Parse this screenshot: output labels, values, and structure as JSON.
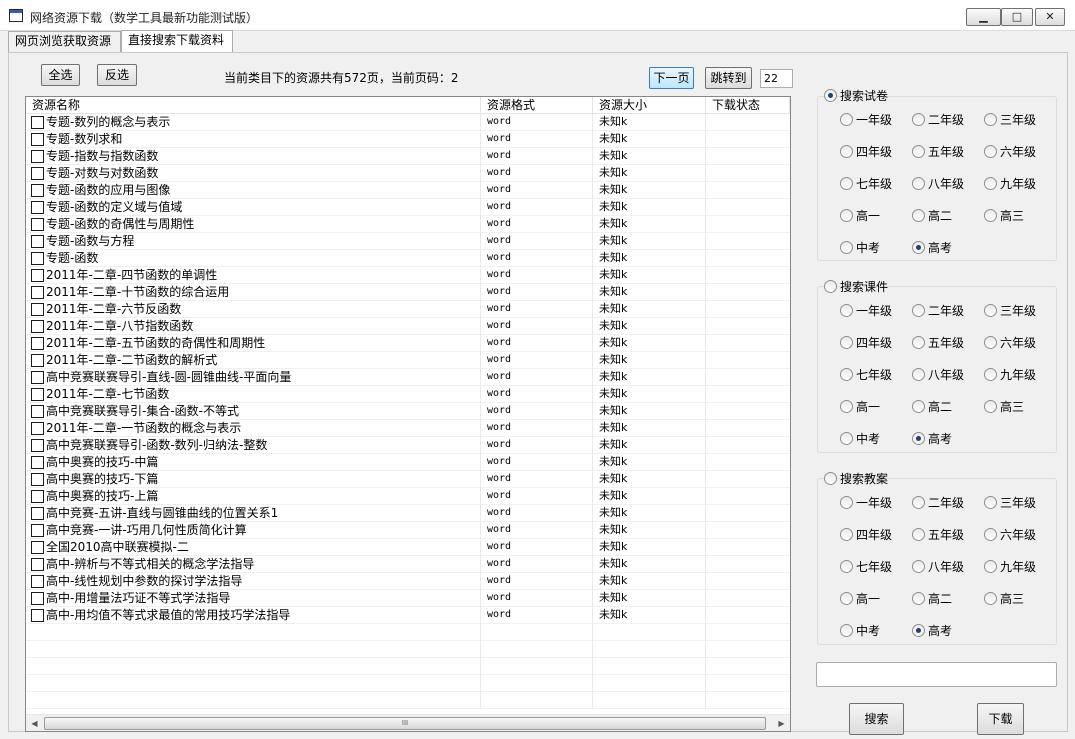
{
  "window": {
    "title": "网络资源下载（数学工具最新功能测试版）",
    "min_symbol": "▁",
    "max_symbol": "□",
    "close_symbol": "✕"
  },
  "tabs": [
    {
      "label": "网页浏览获取资源",
      "active": false
    },
    {
      "label": "直接搜索下载资料",
      "active": true
    }
  ],
  "toolbar": {
    "select_all": "全选",
    "invert_select": "反选",
    "info": "当前类目下的资源共有572页，当前页码：2",
    "next_page": "下一页",
    "jump_to": "跳转到",
    "page_input": "22"
  },
  "list": {
    "columns": [
      "资源名称",
      "资源格式",
      "资源大小",
      "下载状态"
    ],
    "rows": [
      {
        "name": "专题-数列的概念与表示",
        "format": "word",
        "size": "未知k",
        "status": ""
      },
      {
        "name": "专题-数列求和",
        "format": "word",
        "size": "未知k",
        "status": ""
      },
      {
        "name": "专题-指数与指数函数",
        "format": "word",
        "size": "未知k",
        "status": ""
      },
      {
        "name": "专题-对数与对数函数",
        "format": "word",
        "size": "未知k",
        "status": ""
      },
      {
        "name": "专题-函数的应用与图像",
        "format": "word",
        "size": "未知k",
        "status": ""
      },
      {
        "name": "专题-函数的定义域与值域",
        "format": "word",
        "size": "未知k",
        "status": ""
      },
      {
        "name": "专题-函数的奇偶性与周期性",
        "format": "word",
        "size": "未知k",
        "status": ""
      },
      {
        "name": "专题-函数与方程",
        "format": "word",
        "size": "未知k",
        "status": ""
      },
      {
        "name": "专题-函数",
        "format": "word",
        "size": "未知k",
        "status": ""
      },
      {
        "name": "2011年-二章-四节函数的单调性",
        "format": "word",
        "size": "未知k",
        "status": ""
      },
      {
        "name": "2011年-二章-十节函数的综合运用",
        "format": "word",
        "size": "未知k",
        "status": ""
      },
      {
        "name": "2011年-二章-六节反函数",
        "format": "word",
        "size": "未知k",
        "status": ""
      },
      {
        "name": "2011年-二章-八节指数函数",
        "format": "word",
        "size": "未知k",
        "status": ""
      },
      {
        "name": "2011年-二章-五节函数的奇偶性和周期性",
        "format": "word",
        "size": "未知k",
        "status": ""
      },
      {
        "name": "2011年-二章-二节函数的解析式",
        "format": "word",
        "size": "未知k",
        "status": ""
      },
      {
        "name": "高中竞赛联赛导引-直线-圆-圆锥曲线-平面向量",
        "format": "word",
        "size": "未知k",
        "status": ""
      },
      {
        "name": "2011年-二章-七节函数",
        "format": "word",
        "size": "未知k",
        "status": ""
      },
      {
        "name": "高中竞赛联赛导引-集合-函数-不等式",
        "format": "word",
        "size": "未知k",
        "status": ""
      },
      {
        "name": "2011年-二章-一节函数的概念与表示",
        "format": "word",
        "size": "未知k",
        "status": ""
      },
      {
        "name": "高中竞赛联赛导引-函数-数列-归纳法-整数",
        "format": "word",
        "size": "未知k",
        "status": ""
      },
      {
        "name": "高中奥赛的技巧-中篇",
        "format": "word",
        "size": "未知k",
        "status": ""
      },
      {
        "name": "高中奥赛的技巧-下篇",
        "format": "word",
        "size": "未知k",
        "status": ""
      },
      {
        "name": "高中奥赛的技巧-上篇",
        "format": "word",
        "size": "未知k",
        "status": ""
      },
      {
        "name": "高中竞赛-五讲-直线与圆锥曲线的位置关系1",
        "format": "word",
        "size": "未知k",
        "status": ""
      },
      {
        "name": "高中竞赛-一讲-巧用几何性质简化计算",
        "format": "word",
        "size": "未知k",
        "status": ""
      },
      {
        "name": "全国2010高中联赛模拟-二",
        "format": "word",
        "size": "未知k",
        "status": ""
      },
      {
        "name": "高中-辨析与不等式相关的概念学法指导",
        "format": "word",
        "size": "未知k",
        "status": ""
      },
      {
        "name": "高中-线性规划中参数的探讨学法指导",
        "format": "word",
        "size": "未知k",
        "status": ""
      },
      {
        "name": "高中-用增量法巧证不等式学法指导",
        "format": "word",
        "size": "未知k",
        "status": ""
      },
      {
        "name": "高中-用均值不等式求最值的常用技巧学法指导",
        "format": "word",
        "size": "未知k",
        "status": ""
      }
    ],
    "scroll_grip": "III"
  },
  "grades": [
    "一年级",
    "二年级",
    "三年级",
    "四年级",
    "五年级",
    "六年级",
    "七年级",
    "八年级",
    "九年级",
    "高一",
    "高二",
    "高三",
    "中考",
    "高考"
  ],
  "groups": [
    {
      "title": "搜索试卷",
      "selected": true,
      "selected_grade": "高考"
    },
    {
      "title": "搜索课件",
      "selected": false,
      "selected_grade": "高考"
    },
    {
      "title": "搜索教案",
      "selected": false,
      "selected_grade": "高考"
    }
  ],
  "search_input": "",
  "actions": {
    "search": "搜索",
    "download": "下载"
  }
}
